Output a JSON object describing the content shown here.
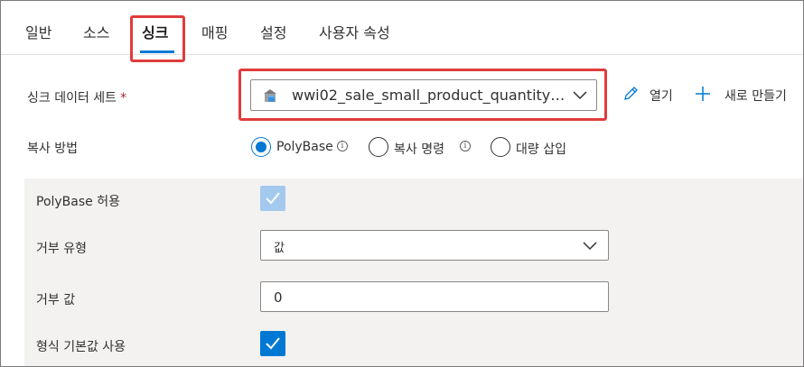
{
  "tabs": [
    {
      "label": "일반"
    },
    {
      "label": "소스"
    },
    {
      "label": "싱크"
    },
    {
      "label": "매핑"
    },
    {
      "label": "설정"
    },
    {
      "label": "사용자 속성"
    }
  ],
  "active_tab": "싱크",
  "sink_dataset": {
    "label": "싱크 데이터 세트",
    "required_mark": "*",
    "value": "wwi02_sale_small_product_quantity_f...",
    "icon": "sql-pool-table-icon",
    "open_label": "열기",
    "new_label": "새로 만들기"
  },
  "copy_method": {
    "label": "복사 방법",
    "options": [
      {
        "label": "PolyBase",
        "selected": true,
        "info": true
      },
      {
        "label": "복사 명령",
        "selected": false,
        "info": true
      },
      {
        "label": "대량 삽입",
        "selected": false,
        "info": false
      }
    ]
  },
  "polybase": {
    "allow_label": "PolyBase 허용",
    "allow_checked": true,
    "reject_type_label": "거부 유형",
    "reject_type_value": "값",
    "reject_value_label": "거부 값",
    "reject_value": "0",
    "use_type_default_label": "형식 기본값 사용",
    "use_type_default_checked": true
  },
  "colors": {
    "accent": "#0078d4",
    "highlight": "#e03c3c",
    "panel_bg": "#f3f2f1"
  }
}
